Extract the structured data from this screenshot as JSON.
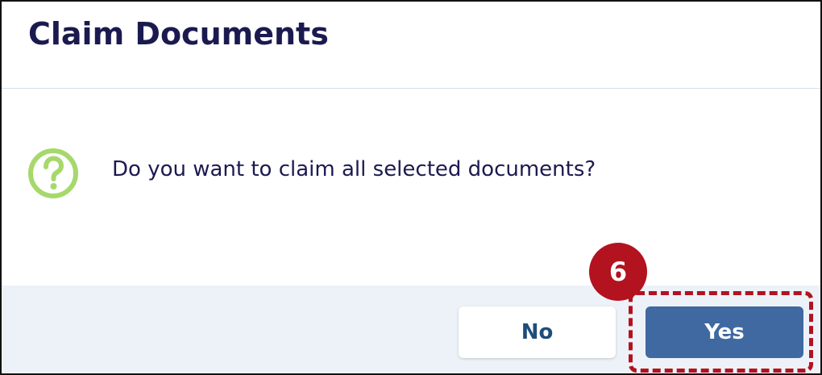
{
  "dialog": {
    "title": "Claim Documents",
    "message": "Do you want to claim all selected documents?",
    "icon": "question-circle-icon",
    "buttons": {
      "no_label": "No",
      "yes_label": "Yes"
    }
  },
  "annotation": {
    "step_number": "6",
    "highlight_color": "#b3121f"
  },
  "colors": {
    "title_text": "#1b1a4f",
    "icon_green": "#a6d86b",
    "footer_bg": "#edf2f9",
    "primary_button": "#3f69a0"
  }
}
